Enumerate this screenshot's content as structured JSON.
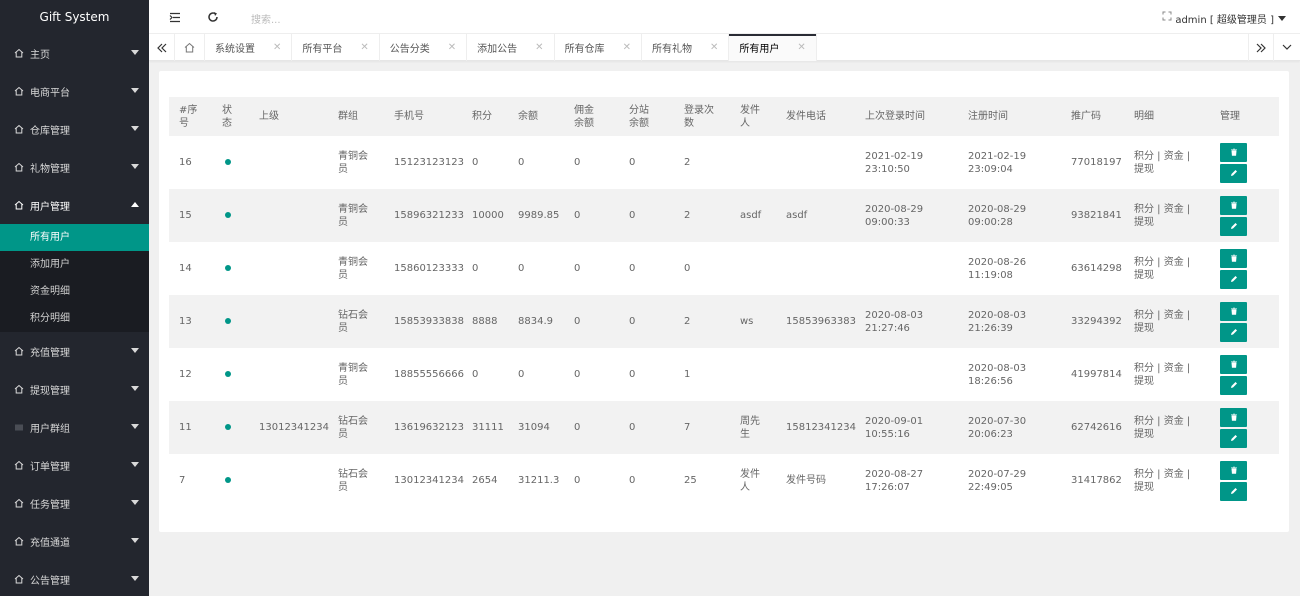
{
  "app": {
    "title": "Gift System"
  },
  "header": {
    "search_placeholder": "搜索...",
    "user_label": "admin [ 超级管理员 ]"
  },
  "sidebar": {
    "items": [
      {
        "label": "主页"
      },
      {
        "label": "电商平台"
      },
      {
        "label": "仓库管理"
      },
      {
        "label": "礼物管理"
      },
      {
        "label": "用户管理"
      },
      {
        "label": "充值管理"
      },
      {
        "label": "提现管理"
      },
      {
        "label": "用户群组"
      },
      {
        "label": "订单管理"
      },
      {
        "label": "任务管理"
      },
      {
        "label": "充值通道"
      },
      {
        "label": "公告管理"
      }
    ],
    "user_submenu": [
      {
        "label": "所有用户"
      },
      {
        "label": "添加用户"
      },
      {
        "label": "资金明细"
      },
      {
        "label": "积分明细"
      }
    ]
  },
  "tabs": [
    {
      "label": "系统设置"
    },
    {
      "label": "所有平台"
    },
    {
      "label": "公告分类"
    },
    {
      "label": "添加公告"
    },
    {
      "label": "所有仓库"
    },
    {
      "label": "所有礼物"
    },
    {
      "label": "所有用户"
    }
  ],
  "table": {
    "headers": [
      "#序号",
      "状态",
      "上级",
      "群组",
      "手机号",
      "积分",
      "余额",
      "佣金余额",
      "分站余额",
      "登录次数",
      "发件人",
      "发件电话",
      "上次登录时间",
      "注册时间",
      "推广码",
      "明细",
      "管理"
    ],
    "detail_links": "积分 | 资金 | 提现",
    "rows": [
      {
        "id": "16",
        "parent": "",
        "group": "青铜会员",
        "phone": "15123123123",
        "points": "0",
        "balance": "0",
        "commission": "0",
        "sub_balance": "0",
        "logins": "2",
        "sender": "",
        "sender_phone": "",
        "last_login": "2021-02-19 23:10:50",
        "registered": "2021-02-19 23:09:04",
        "promo": "77018197"
      },
      {
        "id": "15",
        "parent": "",
        "group": "青铜会员",
        "phone": "15896321233",
        "points": "10000",
        "balance": "9989.85",
        "commission": "0",
        "sub_balance": "0",
        "logins": "2",
        "sender": "asdf",
        "sender_phone": "asdf",
        "last_login": "2020-08-29 09:00:33",
        "registered": "2020-08-29 09:00:28",
        "promo": "93821841"
      },
      {
        "id": "14",
        "parent": "",
        "group": "青铜会员",
        "phone": "15860123333",
        "points": "0",
        "balance": "0",
        "commission": "0",
        "sub_balance": "0",
        "logins": "0",
        "sender": "",
        "sender_phone": "",
        "last_login": "",
        "registered": "2020-08-26 11:19:08",
        "promo": "63614298"
      },
      {
        "id": "13",
        "parent": "",
        "group": "钻石会员",
        "phone": "15853933838",
        "points": "8888",
        "balance": "8834.9",
        "commission": "0",
        "sub_balance": "0",
        "logins": "2",
        "sender": "ws",
        "sender_phone": "15853963383",
        "last_login": "2020-08-03 21:27:46",
        "registered": "2020-08-03 21:26:39",
        "promo": "33294392"
      },
      {
        "id": "12",
        "parent": "",
        "group": "青铜会员",
        "phone": "18855556666",
        "points": "0",
        "balance": "0",
        "commission": "0",
        "sub_balance": "0",
        "logins": "1",
        "sender": "",
        "sender_phone": "",
        "last_login": "",
        "registered": "2020-08-03 18:26:56",
        "promo": "41997814"
      },
      {
        "id": "11",
        "parent": "13012341234",
        "group": "钻石会员",
        "phone": "13619632123",
        "points": "31111",
        "balance": "31094",
        "commission": "0",
        "sub_balance": "0",
        "logins": "7",
        "sender": "周先生",
        "sender_phone": "15812341234",
        "last_login": "2020-09-01 10:55:16",
        "registered": "2020-07-30 20:06:23",
        "promo": "62742616"
      },
      {
        "id": "7",
        "parent": "",
        "group": "钻石会员",
        "phone": "13012341234",
        "points": "2654",
        "balance": "31211.3",
        "commission": "0",
        "sub_balance": "0",
        "logins": "25",
        "sender": "发件人",
        "sender_phone": "发件号码",
        "last_login": "2020-08-27 17:26:07",
        "registered": "2020-07-29 22:49:05",
        "promo": "31417862"
      }
    ]
  },
  "colors": {
    "accent": "#009688",
    "sidebar_bg": "#23262e"
  }
}
